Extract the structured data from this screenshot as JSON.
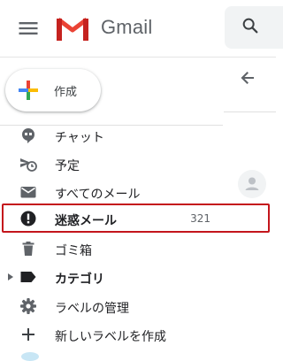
{
  "app": {
    "brand": "Gmail"
  },
  "compose": {
    "label": "作成"
  },
  "sidebar": {
    "items": [
      {
        "label": "チャット",
        "icon": "chat-icon"
      },
      {
        "label": "予定",
        "icon": "scheduled-icon"
      },
      {
        "label": "すべてのメール",
        "icon": "all-mail-icon"
      },
      {
        "label": "迷惑メール",
        "icon": "spam-icon",
        "count": "321",
        "bold": true,
        "highlighted": true
      },
      {
        "label": "ゴミ箱",
        "icon": "trash-icon"
      },
      {
        "label": "カテゴリ",
        "icon": "label-icon",
        "bold": true,
        "expandable": true
      },
      {
        "label": "ラベルの管理",
        "icon": "gear-icon"
      },
      {
        "label": "新しいラベルを作成",
        "icon": "plus-icon"
      }
    ]
  },
  "colors": {
    "highlight": "#c4151c",
    "icon": "#5f6368",
    "text": "#202124"
  }
}
